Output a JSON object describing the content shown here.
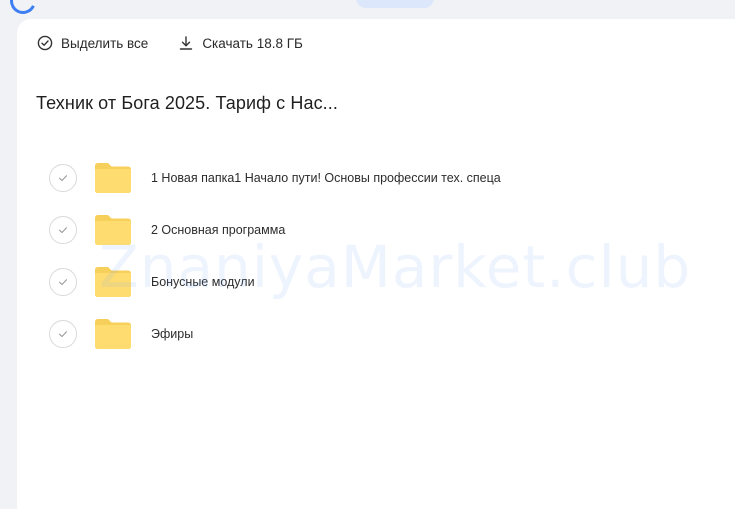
{
  "toolbar": {
    "select_all_label": "Выделить все",
    "download_label": "Скачать 18.8 ГБ"
  },
  "folder": {
    "title": "Техник от Бога 2025. Тариф с Нас..."
  },
  "items": [
    {
      "name": "1 Новая папка1 Начало пути! Основы профессии тех. спеца"
    },
    {
      "name": "2 Основная программа"
    },
    {
      "name": "Бонусные модули"
    },
    {
      "name": "Эфиры"
    }
  ],
  "watermark": "ZnaniyaMarket.club",
  "colors": {
    "folder": "#ffd966",
    "accent": "#3d7ff3"
  }
}
